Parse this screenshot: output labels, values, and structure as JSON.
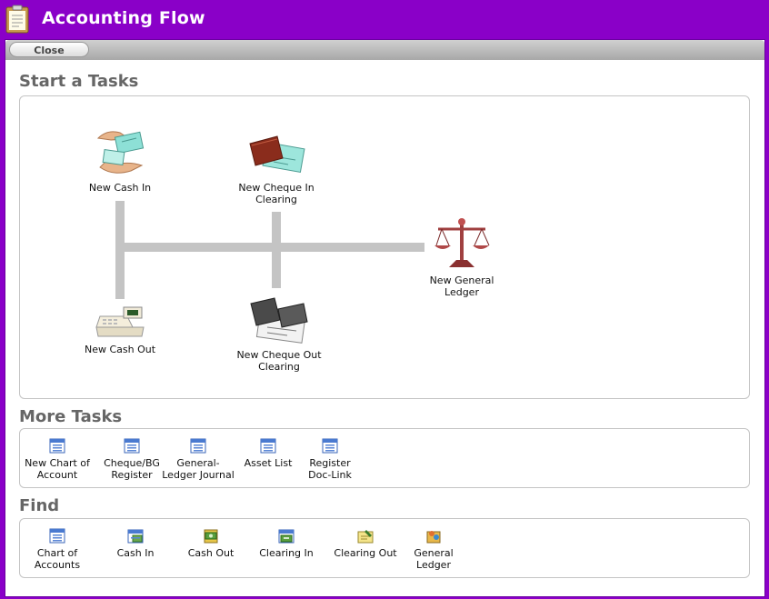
{
  "app": {
    "title": "Accounting Flow"
  },
  "toolbar": {
    "close_label": "Close"
  },
  "start_tasks": {
    "heading": "Start a Tasks",
    "items": [
      {
        "label": "New Cash In",
        "icon": "hands-cheque-icon"
      },
      {
        "label": "New Cheque In Clearing",
        "icon": "wallet-cheque-icon"
      },
      {
        "label": "New General Ledger",
        "icon": "scales-icon"
      },
      {
        "label": "New Cash Out",
        "icon": "cash-register-icon"
      },
      {
        "label": "New Cheque Out Clearing",
        "icon": "wallet-cheque-dark-icon"
      }
    ]
  },
  "more_tasks": {
    "heading": "More Tasks",
    "items": [
      {
        "label": "New Chart of Account",
        "icon": "list-window-icon"
      },
      {
        "label": "Cheque/BG Register",
        "icon": "list-window-icon"
      },
      {
        "label": "General-Ledger Journal",
        "icon": "list-window-icon"
      },
      {
        "label": "Asset List",
        "icon": "list-window-icon"
      },
      {
        "label": "Register Doc-Link",
        "icon": "list-window-icon"
      }
    ]
  },
  "find": {
    "heading": "Find",
    "items": [
      {
        "label": "Chart of Accounts",
        "icon": "list-window-icon"
      },
      {
        "label": "Cash In",
        "icon": "cash-in-icon"
      },
      {
        "label": "Cash Out",
        "icon": "cash-out-icon"
      },
      {
        "label": "Clearing In",
        "icon": "clearing-in-icon"
      },
      {
        "label": "Clearing Out",
        "icon": "clearing-out-icon"
      },
      {
        "label": "General Ledger",
        "icon": "general-ledger-icon"
      }
    ]
  },
  "colors": {
    "title_bar": "#8a00c8",
    "connector": "#c4c4c4",
    "heading": "#666666"
  }
}
